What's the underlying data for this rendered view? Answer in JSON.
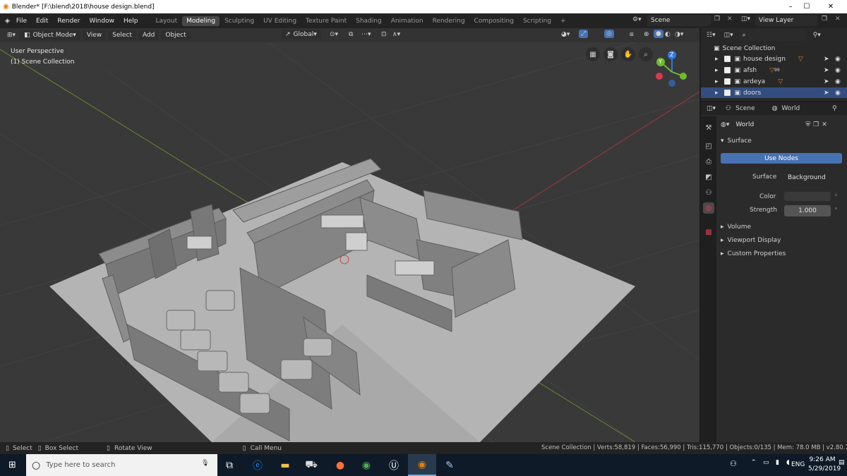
{
  "window": {
    "title": "Blender* [F:\\blend\\2018\\house design.blend]",
    "minimize": "–",
    "maximize": "☐",
    "close": "✕"
  },
  "menu": [
    "File",
    "Edit",
    "Render",
    "Window",
    "Help"
  ],
  "workspaces": [
    "Layout",
    "Modeling",
    "Sculpting",
    "UV Editing",
    "Texture Paint",
    "Shading",
    "Animation",
    "Rendering",
    "Compositing",
    "Scripting",
    "+"
  ],
  "scene_field": "Scene",
  "view_layer": "View Layer",
  "viewport": {
    "mode": "Object Mode",
    "menus": [
      "View",
      "Select",
      "Add",
      "Object"
    ],
    "orientation": "Global",
    "overlay_title": "User Perspective",
    "overlay_collection": "(1) Scene Collection",
    "gizmo_axes": {
      "z": "Z",
      "y": "Y"
    }
  },
  "outliner": {
    "root": "Scene Collection",
    "items": [
      {
        "label": "house design",
        "selected": false
      },
      {
        "label": "afsh",
        "badge": "99",
        "selected": false
      },
      {
        "label": "ardeya",
        "selected": false
      },
      {
        "label": "doors",
        "selected": true
      }
    ]
  },
  "properties": {
    "tab_scene": "Scene",
    "tab_world": "World",
    "world_name": "World",
    "surface_panel": "Surface",
    "use_nodes": "Use Nodes",
    "surface_label": "Surface",
    "surface_value": "Background",
    "color_label": "Color",
    "strength_label": "Strength",
    "strength_value": "1.000",
    "collapsed_panels": [
      "Volume",
      "Viewport Display",
      "Custom Properties"
    ]
  },
  "status": {
    "select": "Select",
    "box_select": "Box Select",
    "rotate": "Rotate View",
    "call_menu": "Call Menu",
    "stats": "Scene Collection | Verts:58,819 | Faces:56,990 | Tris:115,770 | Objects:0/135 | Mem: 78.0 MB | v2.80.72"
  },
  "taskbar": {
    "search_placeholder": "Type here to search",
    "lang": "ENG",
    "time": "9:26 AM",
    "date": "5/29/2019"
  },
  "colors": {
    "accent": "#4772b3",
    "selected_row": "#334d80",
    "viewport_bg": "#393939",
    "floor": "#b4b4b4"
  }
}
